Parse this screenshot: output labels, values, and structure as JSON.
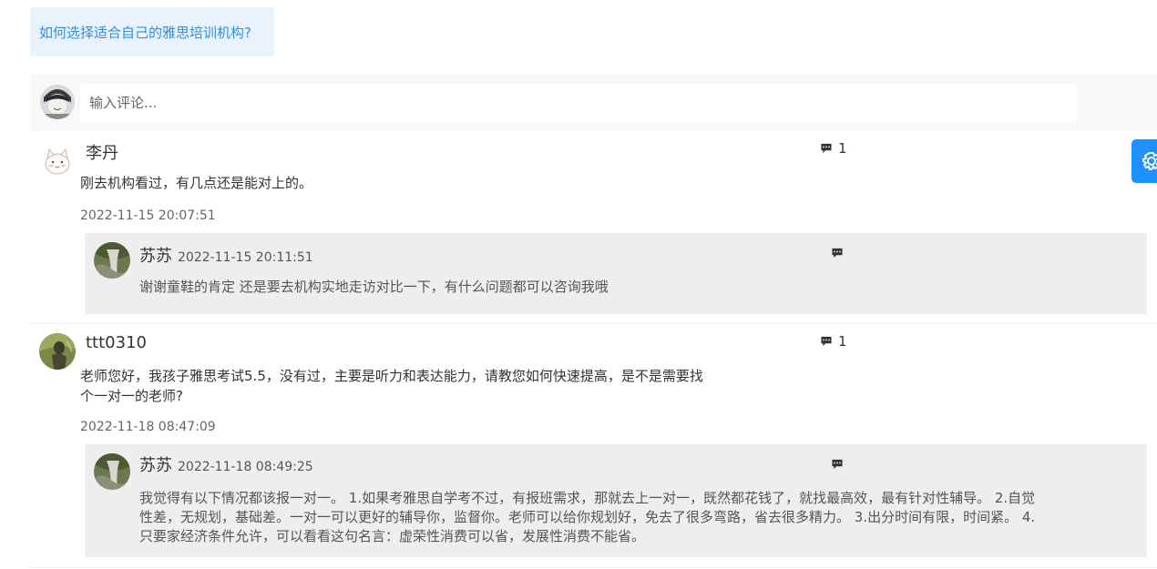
{
  "topic": {
    "label": "如何选择适合自己的雅思培训机构?"
  },
  "comment_box": {
    "placeholder": "输入评论..."
  },
  "comments": [
    {
      "author": "李丹",
      "reply_count": "1",
      "content": "刚去机构看过，有几点还是能对上的。",
      "time": "2022-11-15 20:07:51",
      "reply": {
        "author": "苏苏",
        "time": "2022-11-15 20:11:51",
        "content": "谢谢童鞋的肯定 还是要去机构实地走访对比一下，有什么问题都可以咨询我哦"
      }
    },
    {
      "author": "ttt0310",
      "reply_count": "1",
      "content_lines": [
        "老师您好，我孩子雅思考试5.5，没有过，主要是听力和表达能力，请教您如何快速提高，是不是需要找",
        "个一对一的老师?"
      ],
      "time": "2022-11-18 08:47:09",
      "reply": {
        "author": "苏苏",
        "time": "2022-11-18 08:49:25",
        "content_lines": [
          "我觉得有以下情况都该报一对一。 1.如果考雅思自学考不过，有报班需求，那就去上一对一，既然都花钱了，就找最高效，最有针对性辅导。 2.自觉",
          "性差，无规划，基础差。一对一可以更好的辅导你，监督你。老师可以给你规划好，免去了很多弯路，省去很多精力。 3.出分时间有限，时间紧。 4.",
          "只要家经济条件允许，可以看看这句名言：虚荣性消费可以省，发展性消费不能省。"
        ]
      }
    }
  ],
  "icons": {
    "comment": "speech-bubble-icon",
    "settings": "gear-icon",
    "accent": "#1e90ff",
    "link": "#2f8ee0"
  }
}
